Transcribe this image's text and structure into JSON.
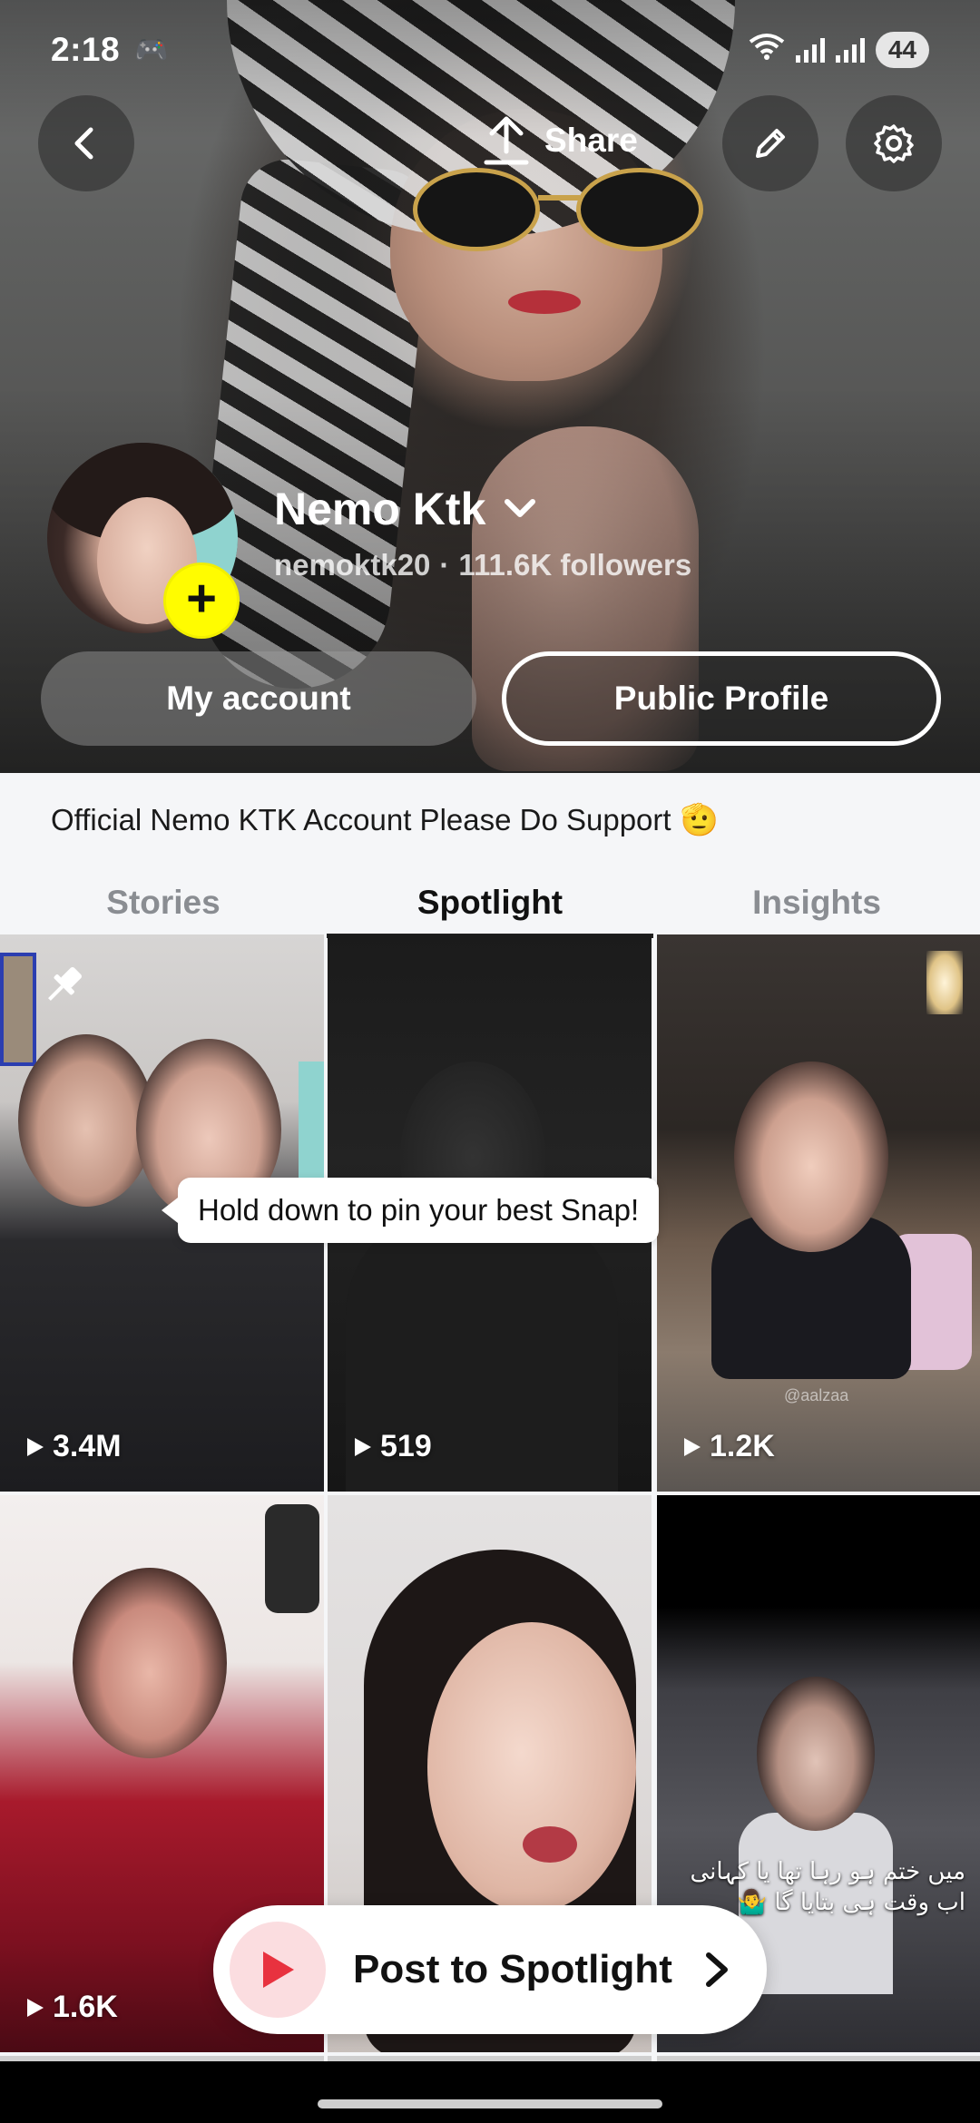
{
  "status_bar": {
    "time": "2:18",
    "battery": "44",
    "icons": [
      "gamepad-icon",
      "wifi-icon",
      "signal-icon",
      "signal-icon"
    ]
  },
  "header": {
    "share_label": "Share",
    "back_icon": "chevron-left-icon",
    "edit_icon": "pencil-icon",
    "settings_icon": "gear-icon"
  },
  "profile": {
    "display_name": "Nemo Ktk",
    "username": "nemoktk20",
    "separator": "·",
    "followers": "111.6K followers",
    "add_story_symbol": "+",
    "my_account_label": "My account",
    "public_profile_label": "Public Profile",
    "bio": "Official Nemo KTK Account Please Do Support",
    "bio_emoji": "🫡"
  },
  "tabs": [
    {
      "label": "Stories",
      "active": false
    },
    {
      "label": "Spotlight",
      "active": true
    },
    {
      "label": "Insights",
      "active": false
    }
  ],
  "tooltip": "Hold down to pin your best Snap!",
  "tiles": [
    {
      "views": "3.4M"
    },
    {
      "views": "519"
    },
    {
      "views": "1.2K",
      "watermark": "@aalzaa"
    },
    {
      "views": "1.6K"
    },
    {
      "views": ""
    },
    {
      "views": "",
      "caption_line1": "میں ختم ہو رہا تھا یا کہانی",
      "caption_line2": "اب وقت ہی بتایا گا 🤷‍♂️"
    }
  ],
  "post_button": {
    "label": "Post to Spotlight"
  },
  "colors": {
    "snap_yellow": "#fffc00",
    "play_red": "#e8323f",
    "play_bg": "#fbdde0"
  }
}
